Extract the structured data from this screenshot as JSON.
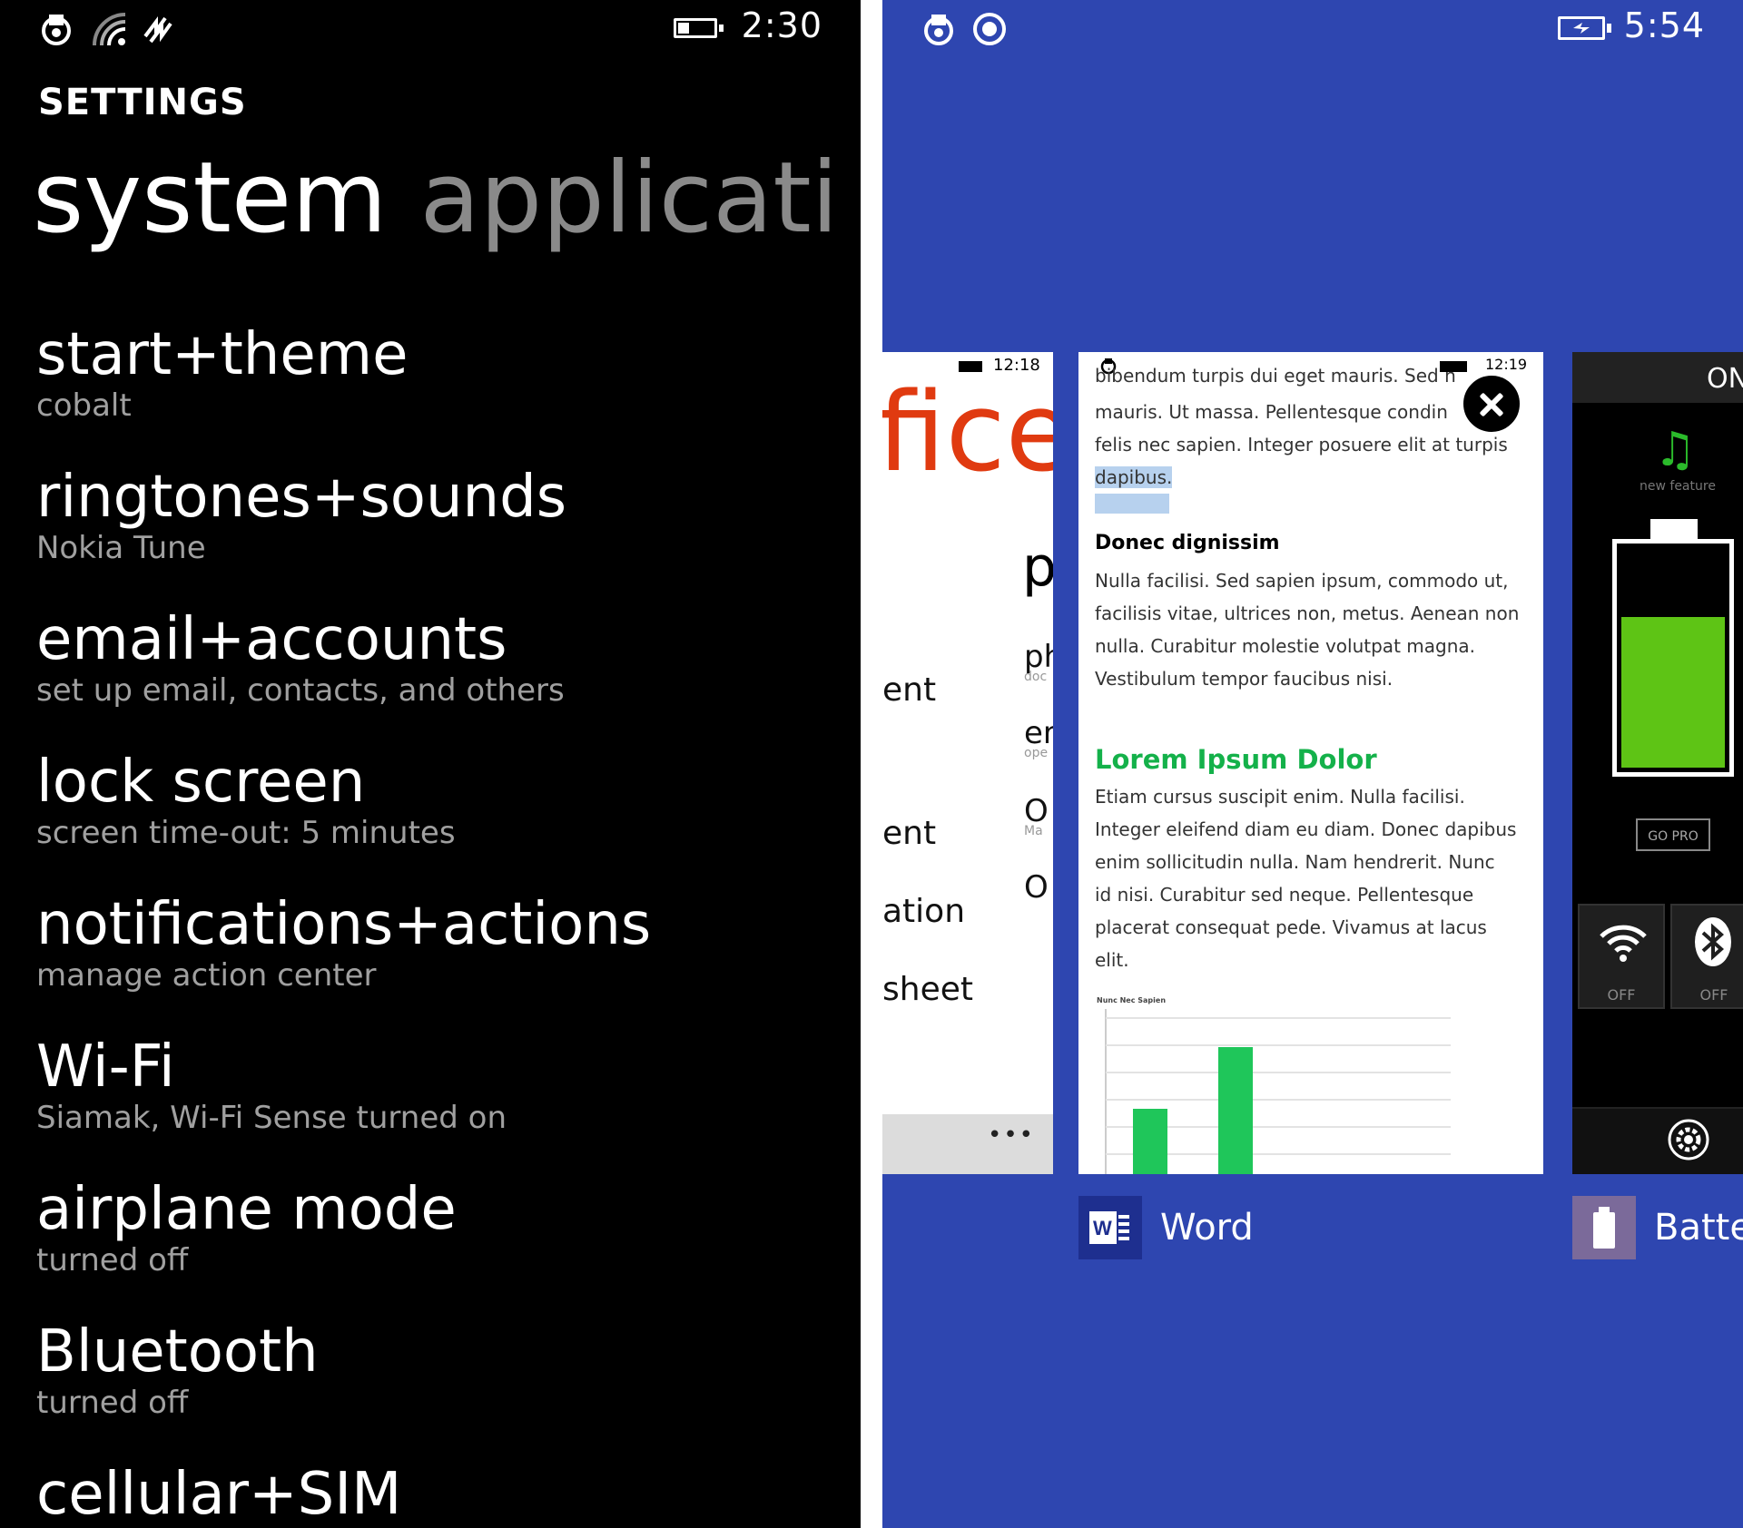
{
  "left_phone": {
    "status": {
      "time": "2:30"
    },
    "header": {
      "label": "SETTINGS"
    },
    "pivot": {
      "active": "system",
      "inactive": "applicati"
    },
    "items": [
      {
        "title": "start+theme",
        "subtitle": "cobalt"
      },
      {
        "title": "ringtones+sounds",
        "subtitle": "Nokia Tune"
      },
      {
        "title": "email+accounts",
        "subtitle": "set up email, contacts, and others"
      },
      {
        "title": "lock screen",
        "subtitle": "screen time-out: 5 minutes"
      },
      {
        "title": "notifications+actions",
        "subtitle": "manage action center"
      },
      {
        "title": "Wi-Fi",
        "subtitle": "Siamak, Wi-Fi Sense turned on"
      },
      {
        "title": "airplane mode",
        "subtitle": "turned off"
      },
      {
        "title": "Bluetooth",
        "subtitle": "turned off"
      },
      {
        "title": "cellular+SIM",
        "subtitle": ""
      }
    ]
  },
  "right_phone": {
    "status": {
      "time": "5:54"
    },
    "office_card": {
      "time": "12:18",
      "brand": "fice",
      "big_letter": "p",
      "rows_left": [
        "ent",
        "ent",
        "ation",
        "sheet"
      ],
      "rows_right": [
        {
          "title": "ph",
          "sub": "doc"
        },
        {
          "title": "er",
          "sub": "ope"
        },
        {
          "title": "O",
          "sub": "Ma"
        },
        {
          "title": "O",
          "sub": ""
        }
      ],
      "menu_dots": "•••"
    },
    "word_card": {
      "time": "12:19",
      "para1_top": "bibendum turpis dui eget mauris. Sed n",
      "para1_l1": "mauris. Ut massa. Pellentesque condin",
      "para1_l2": "felis nec sapien. Integer posuere elit at turpis",
      "para1_hl": "dapibus.",
      "heading1": "Donec dignissim",
      "para2": [
        "Nulla facilisi. Sed sapien ipsum, commodo ut,",
        "facilisis vitae, ultrices non, metus. Aenean non",
        "nulla. Curabitur molestie volutpat magna.",
        "Vestibulum tempor faucibus nisi."
      ],
      "heading2": "Lorem Ipsum Dolor",
      "para3": [
        "Etiam cursus suscipit enim. Nulla facilisi.",
        "Integer eleifend diam eu diam. Donec dapibus",
        "enim sollicitudin nulla. Nam hendrerit. Nunc",
        "id nisi. Curabitur sed neque. Pellentesque",
        "placerat consequat pede. Vivamus at lacus",
        "elit."
      ],
      "chart_title": "Nunc Nec Sapien",
      "chart_bar_color": "#1fc65a"
    },
    "battery_card": {
      "on_label": "ON",
      "feature_text": "new feature",
      "charge_level": 0.7,
      "go_pro": "GO PRO",
      "wifi_state": "OFF",
      "bluetooth_state": "OFF"
    },
    "labels": {
      "word": "Word",
      "battery": "Battery"
    }
  },
  "colors": {
    "accent_cobalt": "#2e46b0",
    "office_red": "#e03a10",
    "word_green": "#14b14a",
    "battery_green": "#5ec415"
  }
}
